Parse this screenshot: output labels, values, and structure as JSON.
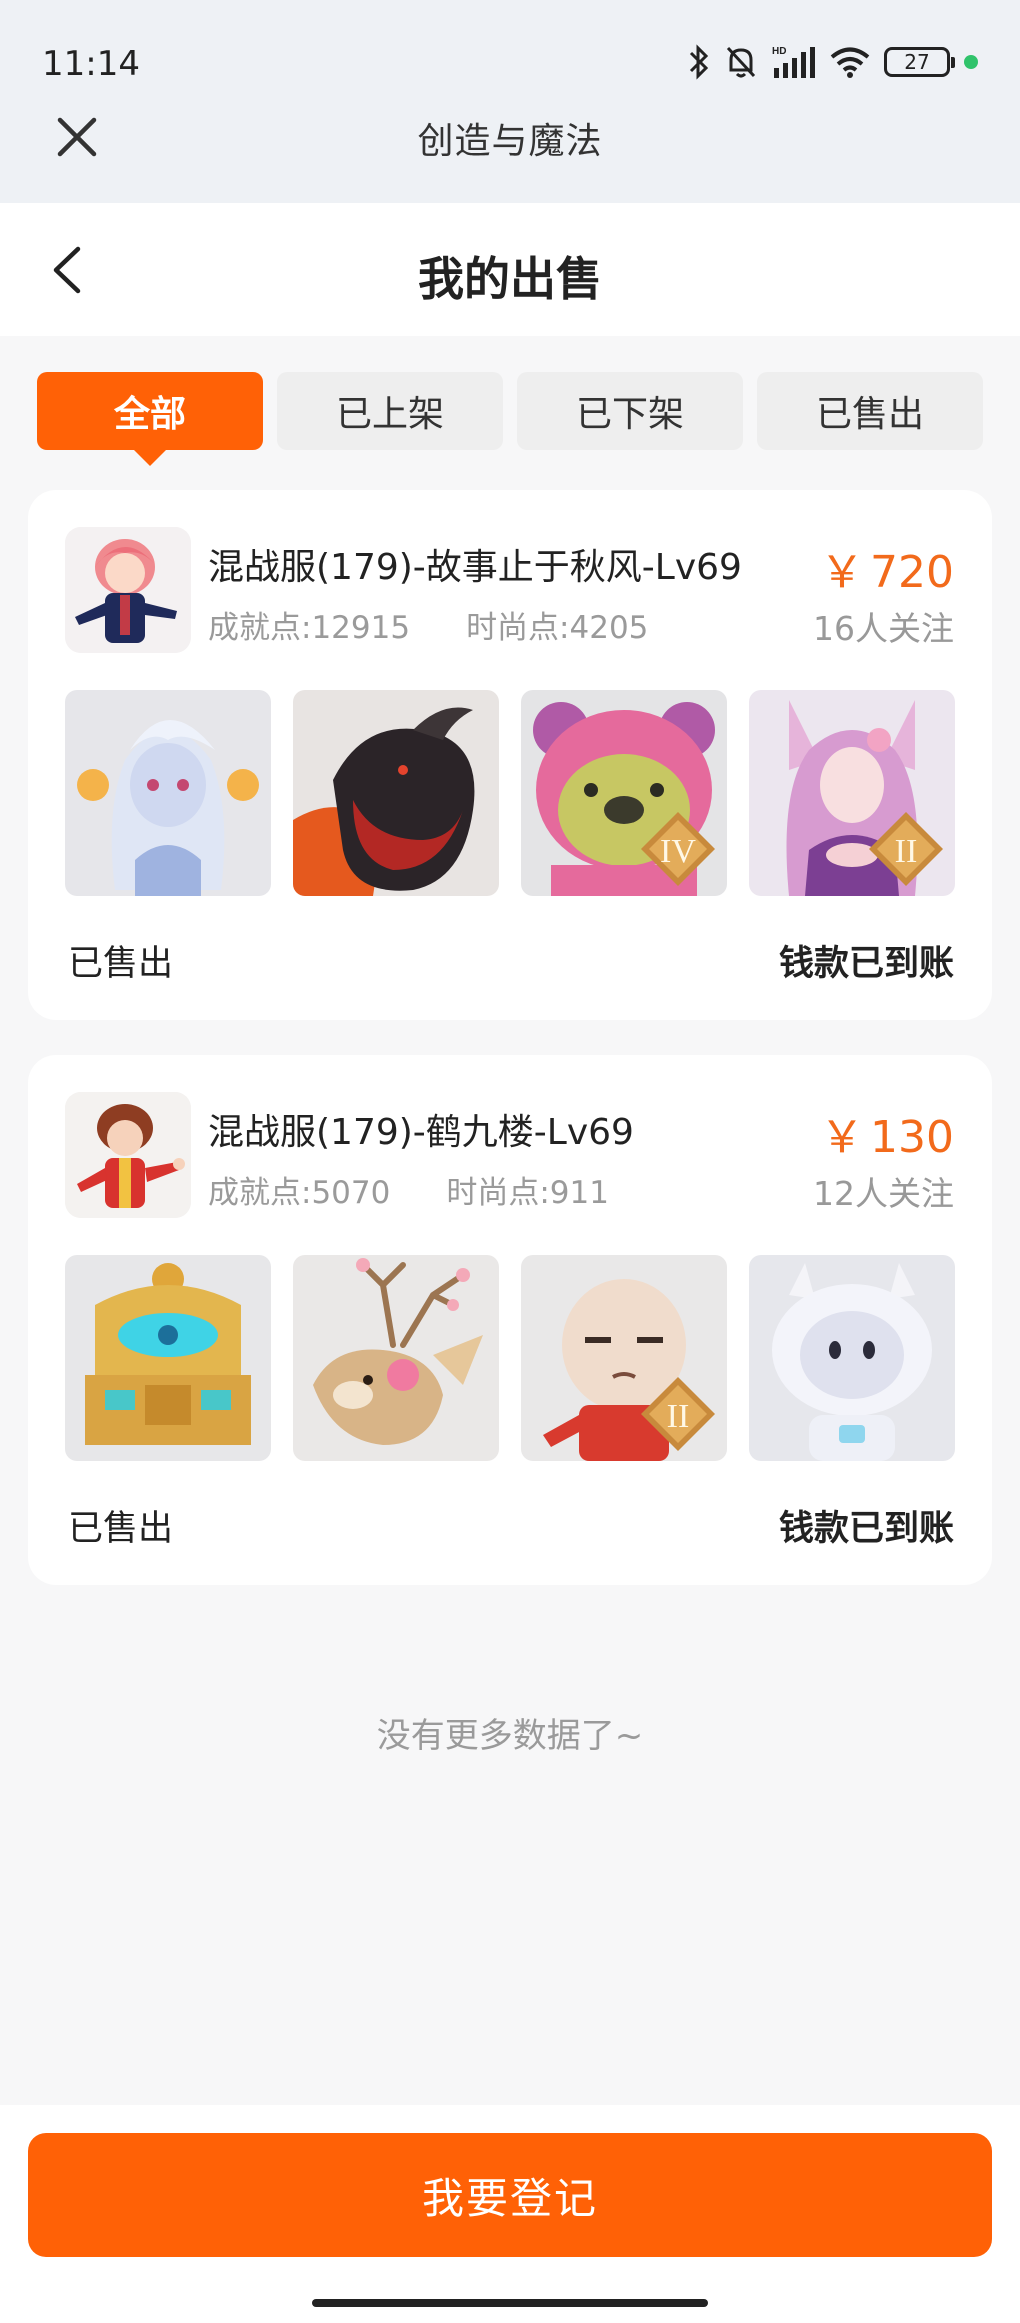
{
  "status_bar": {
    "time": "11:14",
    "battery": "27"
  },
  "mini_app": {
    "title": "创造与魔法"
  },
  "header": {
    "title": "我的出售"
  },
  "tabs": [
    {
      "label": "全部",
      "active": true
    },
    {
      "label": "已上架",
      "active": false
    },
    {
      "label": "已下架",
      "active": false
    },
    {
      "label": "已售出",
      "active": false
    }
  ],
  "listings": [
    {
      "title": "混战服(179)-故事止于秋风-Lv69",
      "achievement": "成就点:12915",
      "fashion": "时尚点:4205",
      "price_symbol": "￥",
      "price": "720",
      "followers": "16人关注",
      "status": "已售出",
      "payment_status": "钱款已到账",
      "items": [
        {
          "icon": "white-spirit-pet-icon"
        },
        {
          "icon": "black-beast-mount-icon"
        },
        {
          "icon": "pink-bear-costume-icon",
          "badge": "IV"
        },
        {
          "icon": "fox-spirit-girl-icon",
          "badge": "II"
        }
      ]
    },
    {
      "title": "混战服(179)-鹤九楼-Lv69",
      "achievement": "成就点:5070",
      "fashion": "时尚点:911",
      "price_symbol": "￥",
      "price": "130",
      "followers": "12人关注",
      "status": "已售出",
      "payment_status": "钱款已到账",
      "items": [
        {
          "icon": "golden-throne-icon"
        },
        {
          "icon": "sakura-deer-icon"
        },
        {
          "icon": "bald-character-icon",
          "badge": "II"
        },
        {
          "icon": "space-cow-icon"
        }
      ]
    }
  ],
  "footer": {
    "no_more": "没有更多数据了~",
    "register_button": "我要登记"
  },
  "colors": {
    "accent": "#ff6106",
    "price": "#f26a1b"
  }
}
